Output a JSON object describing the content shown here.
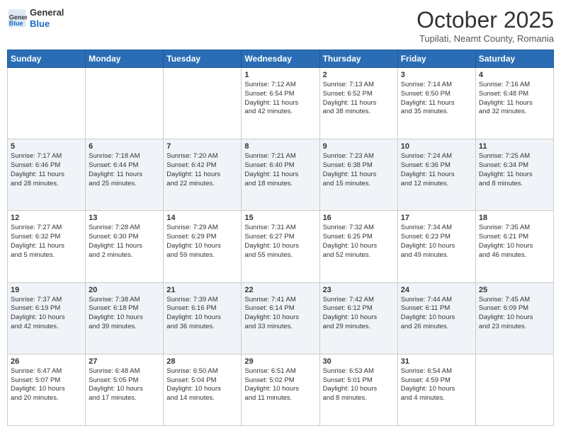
{
  "header": {
    "logo": {
      "general": "General",
      "blue": "Blue"
    },
    "title": "October 2025",
    "subtitle": "Tupilati, Neamt County, Romania"
  },
  "weekdays": [
    "Sunday",
    "Monday",
    "Tuesday",
    "Wednesday",
    "Thursday",
    "Friday",
    "Saturday"
  ],
  "weeks": [
    [
      {
        "day": "",
        "info": ""
      },
      {
        "day": "",
        "info": ""
      },
      {
        "day": "",
        "info": ""
      },
      {
        "day": "1",
        "info": "Sunrise: 7:12 AM\nSunset: 6:54 PM\nDaylight: 11 hours\nand 42 minutes."
      },
      {
        "day": "2",
        "info": "Sunrise: 7:13 AM\nSunset: 6:52 PM\nDaylight: 11 hours\nand 38 minutes."
      },
      {
        "day": "3",
        "info": "Sunrise: 7:14 AM\nSunset: 6:50 PM\nDaylight: 11 hours\nand 35 minutes."
      },
      {
        "day": "4",
        "info": "Sunrise: 7:16 AM\nSunset: 6:48 PM\nDaylight: 11 hours\nand 32 minutes."
      }
    ],
    [
      {
        "day": "5",
        "info": "Sunrise: 7:17 AM\nSunset: 6:46 PM\nDaylight: 11 hours\nand 28 minutes."
      },
      {
        "day": "6",
        "info": "Sunrise: 7:18 AM\nSunset: 6:44 PM\nDaylight: 11 hours\nand 25 minutes."
      },
      {
        "day": "7",
        "info": "Sunrise: 7:20 AM\nSunset: 6:42 PM\nDaylight: 11 hours\nand 22 minutes."
      },
      {
        "day": "8",
        "info": "Sunrise: 7:21 AM\nSunset: 6:40 PM\nDaylight: 11 hours\nand 18 minutes."
      },
      {
        "day": "9",
        "info": "Sunrise: 7:23 AM\nSunset: 6:38 PM\nDaylight: 11 hours\nand 15 minutes."
      },
      {
        "day": "10",
        "info": "Sunrise: 7:24 AM\nSunset: 6:36 PM\nDaylight: 11 hours\nand 12 minutes."
      },
      {
        "day": "11",
        "info": "Sunrise: 7:25 AM\nSunset: 6:34 PM\nDaylight: 11 hours\nand 8 minutes."
      }
    ],
    [
      {
        "day": "12",
        "info": "Sunrise: 7:27 AM\nSunset: 6:32 PM\nDaylight: 11 hours\nand 5 minutes."
      },
      {
        "day": "13",
        "info": "Sunrise: 7:28 AM\nSunset: 6:30 PM\nDaylight: 11 hours\nand 2 minutes."
      },
      {
        "day": "14",
        "info": "Sunrise: 7:29 AM\nSunset: 6:29 PM\nDaylight: 10 hours\nand 59 minutes."
      },
      {
        "day": "15",
        "info": "Sunrise: 7:31 AM\nSunset: 6:27 PM\nDaylight: 10 hours\nand 55 minutes."
      },
      {
        "day": "16",
        "info": "Sunrise: 7:32 AM\nSunset: 6:25 PM\nDaylight: 10 hours\nand 52 minutes."
      },
      {
        "day": "17",
        "info": "Sunrise: 7:34 AM\nSunset: 6:23 PM\nDaylight: 10 hours\nand 49 minutes."
      },
      {
        "day": "18",
        "info": "Sunrise: 7:35 AM\nSunset: 6:21 PM\nDaylight: 10 hours\nand 46 minutes."
      }
    ],
    [
      {
        "day": "19",
        "info": "Sunrise: 7:37 AM\nSunset: 6:19 PM\nDaylight: 10 hours\nand 42 minutes."
      },
      {
        "day": "20",
        "info": "Sunrise: 7:38 AM\nSunset: 6:18 PM\nDaylight: 10 hours\nand 39 minutes."
      },
      {
        "day": "21",
        "info": "Sunrise: 7:39 AM\nSunset: 6:16 PM\nDaylight: 10 hours\nand 36 minutes."
      },
      {
        "day": "22",
        "info": "Sunrise: 7:41 AM\nSunset: 6:14 PM\nDaylight: 10 hours\nand 33 minutes."
      },
      {
        "day": "23",
        "info": "Sunrise: 7:42 AM\nSunset: 6:12 PM\nDaylight: 10 hours\nand 29 minutes."
      },
      {
        "day": "24",
        "info": "Sunrise: 7:44 AM\nSunset: 6:11 PM\nDaylight: 10 hours\nand 26 minutes."
      },
      {
        "day": "25",
        "info": "Sunrise: 7:45 AM\nSunset: 6:09 PM\nDaylight: 10 hours\nand 23 minutes."
      }
    ],
    [
      {
        "day": "26",
        "info": "Sunrise: 6:47 AM\nSunset: 5:07 PM\nDaylight: 10 hours\nand 20 minutes."
      },
      {
        "day": "27",
        "info": "Sunrise: 6:48 AM\nSunset: 5:05 PM\nDaylight: 10 hours\nand 17 minutes."
      },
      {
        "day": "28",
        "info": "Sunrise: 6:50 AM\nSunset: 5:04 PM\nDaylight: 10 hours\nand 14 minutes."
      },
      {
        "day": "29",
        "info": "Sunrise: 6:51 AM\nSunset: 5:02 PM\nDaylight: 10 hours\nand 11 minutes."
      },
      {
        "day": "30",
        "info": "Sunrise: 6:53 AM\nSunset: 5:01 PM\nDaylight: 10 hours\nand 8 minutes."
      },
      {
        "day": "31",
        "info": "Sunrise: 6:54 AM\nSunset: 4:59 PM\nDaylight: 10 hours\nand 4 minutes."
      },
      {
        "day": "",
        "info": ""
      }
    ]
  ]
}
